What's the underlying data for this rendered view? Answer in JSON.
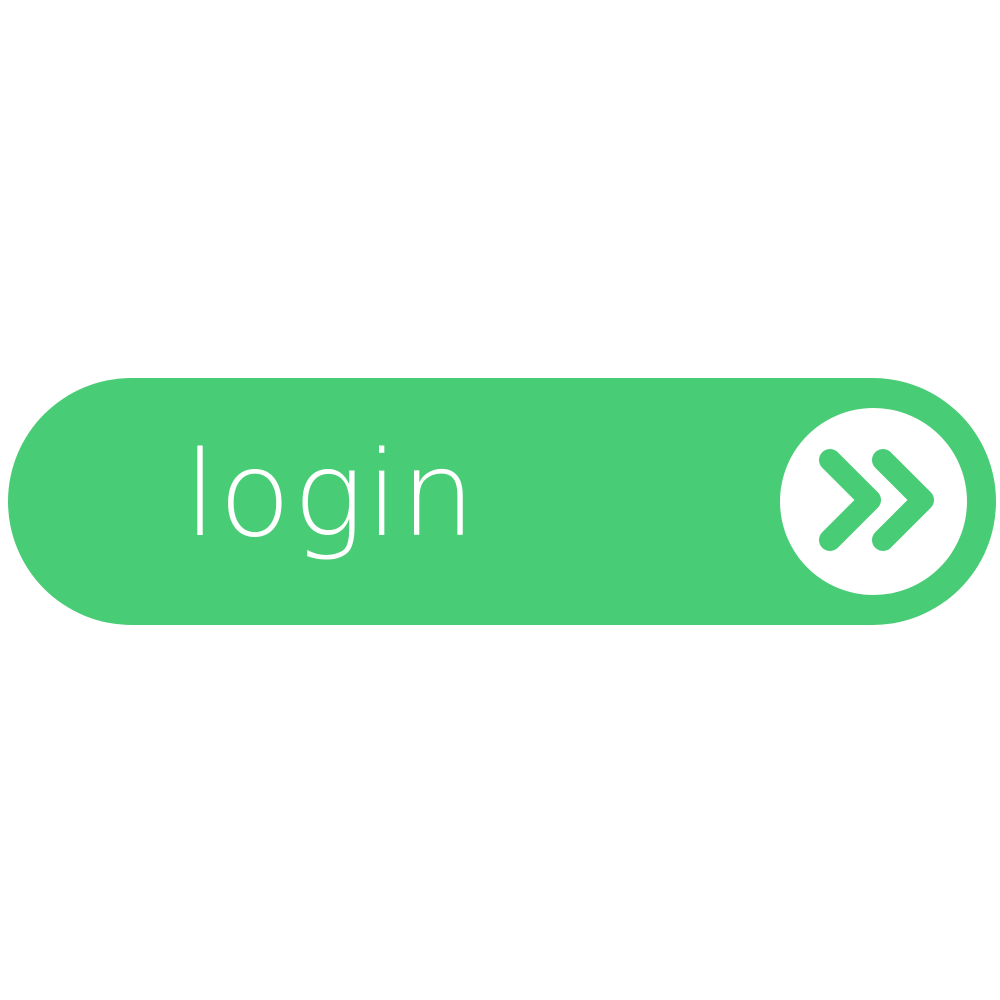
{
  "login_button": {
    "label": "login",
    "icon": "double-chevron-right-icon"
  },
  "colors": {
    "accent": "#49cc76",
    "text": "#ffffff",
    "background": "#ffffff"
  }
}
